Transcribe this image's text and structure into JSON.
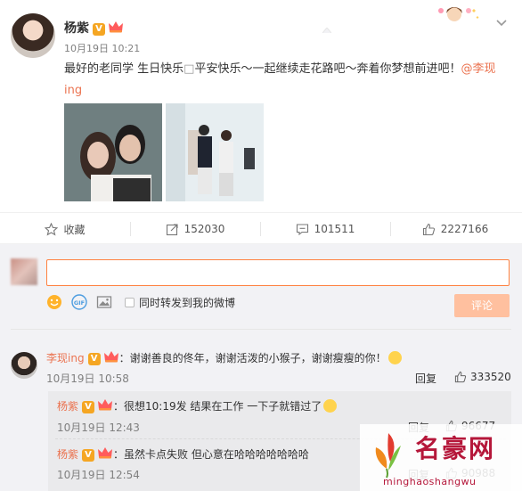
{
  "post": {
    "username": "杨紫",
    "verified_badge": "V",
    "time": "10月19日 10:21",
    "text": "最好的老同学 生日快乐",
    "text_symbol": "□",
    "text_cont": "平安快乐～一起继续走花路吧～奔着你梦想前进吧！",
    "mention": "@李现ing",
    "icons": {
      "verified": "v-badge-icon",
      "vip": "crown-icon",
      "sticker": "decorative-sticker-icon",
      "dropdown": "chevron-down-icon"
    }
  },
  "actions": {
    "collect_label": "收藏",
    "forward_count": "152030",
    "comment_count": "101511",
    "like_count": "2227166"
  },
  "composer": {
    "placeholder": "",
    "forward_label": "同时转发到我的微博",
    "submit_label": "评论",
    "icons": [
      "smile-icon",
      "gif-icon",
      "image-icon"
    ]
  },
  "comments": [
    {
      "author": "李现ing",
      "text": "：谢谢善良的佟年，谢谢活泼的小猴子，谢谢瘦瘦的你！",
      "time": "10月19日 10:58",
      "reply_label": "回复",
      "likes": "333520",
      "replies": [
        {
          "author": "杨紫",
          "text": "：很想10:19发 结果在工作 一下子就错过了",
          "time": "10月19日 12:43",
          "reply_label": "回复",
          "likes": "96677"
        },
        {
          "author": "杨紫",
          "text": "：虽然卡点失败 但心意在哈哈哈哈哈哈哈",
          "time": "10月19日 12:54",
          "reply_label": "回复",
          "likes": "90988"
        }
      ]
    }
  ],
  "watermark": {
    "title": "名豪网",
    "url": "minghaoshangwu"
  },
  "colors": {
    "accent": "#eb7350",
    "input_border": "#ff8140",
    "submit_bg": "#ffc09f",
    "panel_bg": "#f2f2f5",
    "watermark": "#b5173a"
  }
}
